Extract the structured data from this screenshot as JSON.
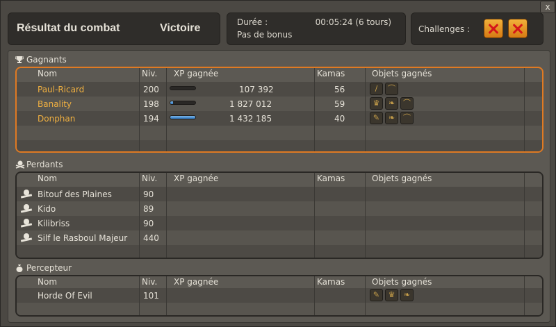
{
  "window": {
    "close_label": "x"
  },
  "header": {
    "title": "Résultat du combat",
    "result": "Victoire",
    "duration_label": "Durée :",
    "duration_value": "00:05:24 (6 tours)",
    "bonus": "Pas de bonus",
    "challenges_label": "Challenges :"
  },
  "columns": [
    "Nom",
    "Niv.",
    "XP gagnée",
    "Kamas",
    "Objets gagnés"
  ],
  "winners": {
    "label": "Gagnants",
    "rows": [
      {
        "name": "Paul-Ricard",
        "level": "200",
        "xp": "107 392",
        "kamas": "56",
        "xp_fill": 0.0,
        "items": [
          "wand-icon",
          "bow-icon"
        ]
      },
      {
        "name": "Banality",
        "level": "198",
        "xp": "1 827 012",
        "kamas": "59",
        "xp_fill": 0.12,
        "items": [
          "crown-icon",
          "feather-icon",
          "bow-icon"
        ]
      },
      {
        "name": "Donphan",
        "level": "194",
        "xp": "1 432 185",
        "kamas": "40",
        "xp_fill": 1.0,
        "items": [
          "leaf-icon",
          "feather-icon",
          "bow-icon"
        ]
      }
    ]
  },
  "losers": {
    "label": "Perdants",
    "rows": [
      {
        "name": "Bitouf des Plaines",
        "level": "90"
      },
      {
        "name": "Kido",
        "level": "89"
      },
      {
        "name": "Kilibriss",
        "level": "90"
      },
      {
        "name": "Silf le Rasboul Majeur",
        "level": "440"
      }
    ]
  },
  "collector": {
    "label": "Percepteur",
    "rows": [
      {
        "name": "Horde Of Evil",
        "level": "101",
        "items": [
          "leaf-icon",
          "crown-icon",
          "feather-icon"
        ]
      }
    ]
  },
  "colors": {
    "winner_name": "#f0b041",
    "winner_border": "#e07a22",
    "xp_bar": "#2f79c4"
  }
}
